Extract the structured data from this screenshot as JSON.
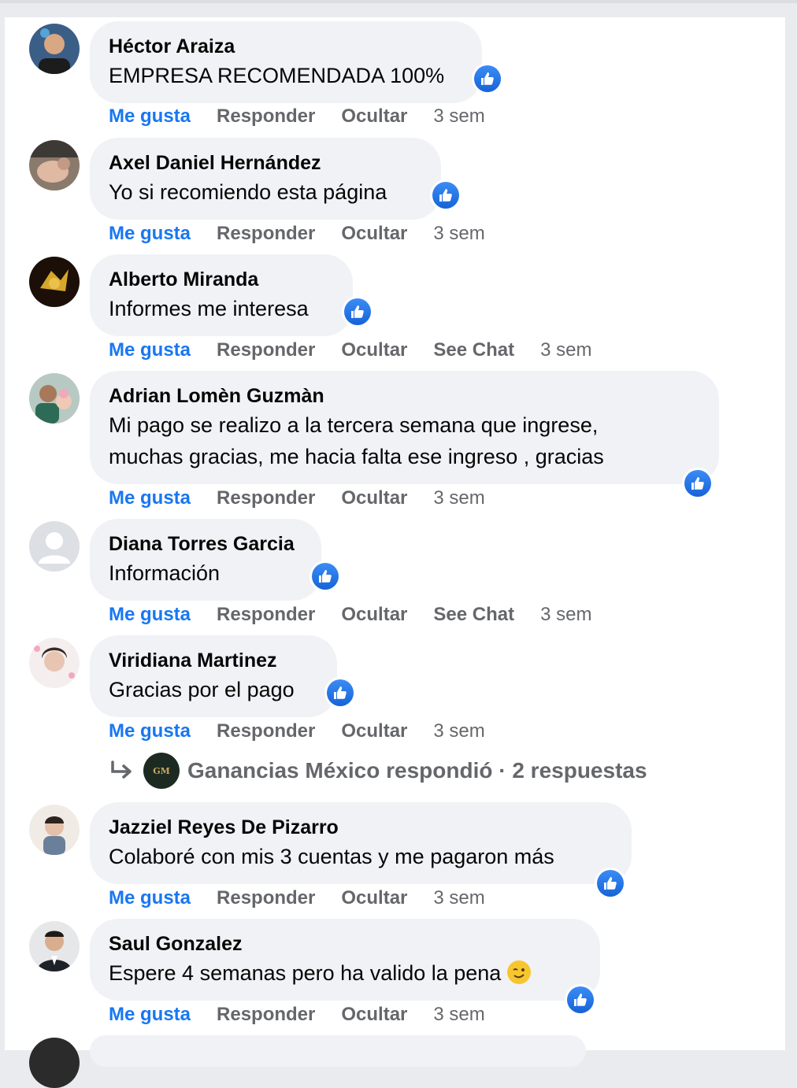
{
  "actions": {
    "like": "Me gusta",
    "reply": "Responder",
    "hide": "Ocultar",
    "see_chat": "See Chat"
  },
  "comments": [
    {
      "author": "Héctor Araiza",
      "text": "EMPRESA RECOMENDADA 100%",
      "time": "3 sem"
    },
    {
      "author": "Axel Daniel Hernández",
      "text": "Yo si recomiendo esta página",
      "time": "3 sem"
    },
    {
      "author": "Alberto Miranda",
      "text": "Informes me interesa",
      "time": "3 sem"
    },
    {
      "author": "Adrian Lomèn Guzmàn",
      "text_line1": "Mi pago se realizo a la tercera semana que ingrese,",
      "text_line2": "muchas gracias, me hacia falta ese ingreso , gracias",
      "time": "3 sem"
    },
    {
      "author": "Diana Torres Garcia",
      "text": "Información",
      "time": "3 sem"
    },
    {
      "author": "Viridiana Martinez",
      "text": "Gracias por el pago",
      "time": "3 sem"
    },
    {
      "author": "Jazziel Reyes De Pizarro",
      "text": "Colaboré con mis 3 cuentas y me pagaron más",
      "time": "3 sem"
    },
    {
      "author": "Saul Gonzalez",
      "text": "Espere 4 semanas pero ha valido la pena",
      "time": "3 sem"
    }
  ],
  "reply_summary": {
    "text": "Ganancias México respondió · 2 respuestas",
    "page_logo_text": "GM"
  },
  "colors": {
    "like_blue": "#1877f2",
    "bubble": "#f0f2f5",
    "muted": "#65676b"
  }
}
